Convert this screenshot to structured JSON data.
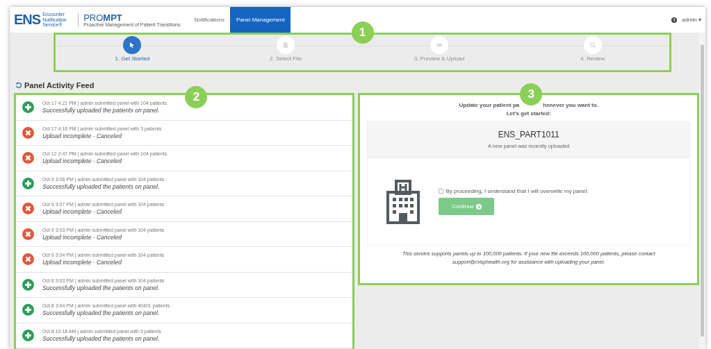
{
  "header": {
    "logo_mark": "ENS",
    "logo_service": "Encounter Notification Service®",
    "product": "PRO**MPT**",
    "tagline": "Proactive Management of Patient Transitions",
    "nav": [
      {
        "label": "Notifications",
        "selected": false
      },
      {
        "label": "Panel Management",
        "selected": true
      }
    ],
    "user": "admin ▾"
  },
  "steps": {
    "callout": "1",
    "items": [
      {
        "label": "1. Get Started",
        "selected": true
      },
      {
        "label": "2. Select File",
        "selected": false
      },
      {
        "label": "3. Preview & Upload",
        "selected": false
      },
      {
        "label": "4. Review",
        "selected": false
      }
    ]
  },
  "feed": {
    "title": "Panel Activity Feed",
    "callout": "2",
    "items": [
      {
        "kind": "success",
        "meta": "Oct 17 4:21 PM | admin submitted panel with 104 patients",
        "message": "Successfully uploaded the patients on panel."
      },
      {
        "kind": "error",
        "meta": "Oct 17 4:16 PM | admin submitted panel with 3 patients",
        "message": "Upload incomplete - Canceled"
      },
      {
        "kind": "error",
        "meta": "Oct 12 2:47 PM | admin submitted panel with 104 patients",
        "message": "Upload incomplete - Canceled"
      },
      {
        "kind": "success",
        "meta": "Oct 9 3:06 PM | admin submitted panel with 104 patients",
        "message": "Successfully uploaded the patients on panel."
      },
      {
        "kind": "error",
        "meta": "Oct 9 3:07 PM | admin submitted panel with 104 patients",
        "message": "Upload incomplete - Canceled"
      },
      {
        "kind": "error",
        "meta": "Oct 9 3:03 PM | admin submitted panel with 104 patients",
        "message": "Upload incomplete - Canceled"
      },
      {
        "kind": "error",
        "meta": "Oct 9 3:04 PM | admin submitted panel with 104 patients",
        "message": "Upload incomplete - Canceled"
      },
      {
        "kind": "success",
        "meta": "Oct 8 3:03 PM | admin submitted panel with 104 patients",
        "message": "Successfully uploaded the patients on panel."
      },
      {
        "kind": "success",
        "meta": "Oct 8 3:04 PM | admin submitted panel with 40401 patients",
        "message": "Successfully uploaded the patients on panel."
      },
      {
        "kind": "success",
        "meta": "Oct 8 10:18 AM | admin submitted panel with 3 patients",
        "message": "Successfully uploaded the patients on panel."
      }
    ]
  },
  "panel": {
    "callout": "3",
    "heading_before": "Update your patient pa",
    "heading_after": "henever you want to.",
    "subheading": "Let’s get started:",
    "panel_name": "ENS_PART1011",
    "panel_note": "A new panel was recently uploaded",
    "checkbox": {
      "label": "By proceeding, I understand that I will overwrite my panel.",
      "checked": false
    },
    "button": {
      "label": "Continue",
      "disabled": true
    },
    "note": "This service supports panels up to 100,000 patients. If your new file exceeds 100,000 patients, please contact support@crisphealth.org for assistance with uploading your panel."
  }
}
